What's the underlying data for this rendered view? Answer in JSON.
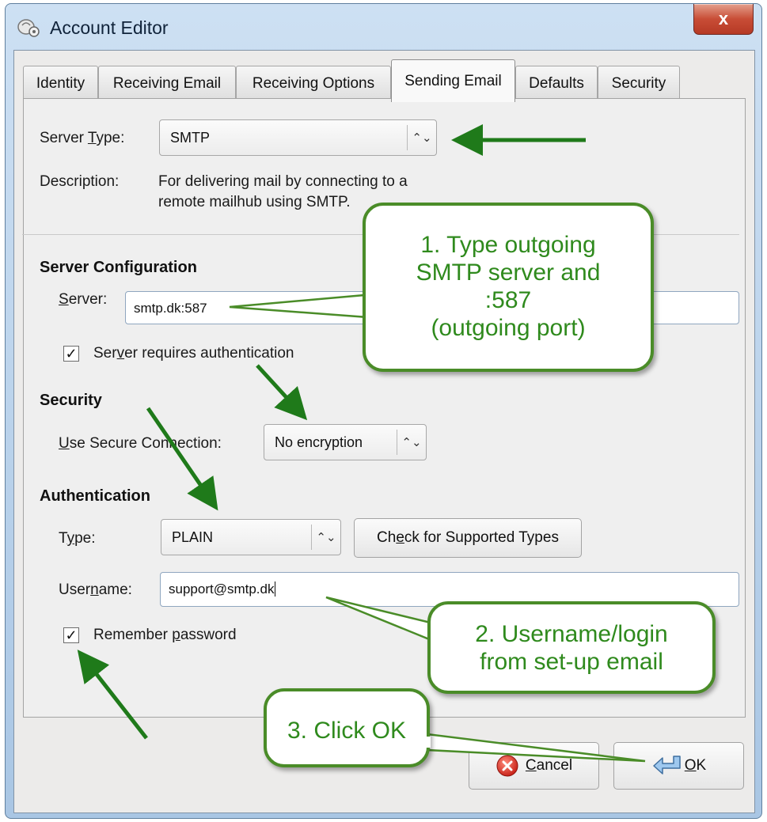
{
  "window": {
    "title": "Account Editor",
    "close_label": "x"
  },
  "tabs": [
    {
      "label": "Identity"
    },
    {
      "label": "Receiving Email"
    },
    {
      "label": "Receiving Options"
    },
    {
      "label": "Sending Email"
    },
    {
      "label": "Defaults"
    },
    {
      "label": "Security"
    }
  ],
  "server_type": {
    "label_pre": "Server ",
    "label_ul": "T",
    "label_post": "ype:",
    "value": "SMTP",
    "description_label": "Description:",
    "description_line1": "For delivering mail by connecting to a",
    "description_line2": "remote mailhub using SMTP."
  },
  "server_config": {
    "heading": "Server Configuration",
    "server_label_ul": "S",
    "server_label_post": "erver:",
    "server_value": "smtp.dk:587",
    "auth_check_pre": "Ser",
    "auth_check_ul": "v",
    "auth_check_post": "er requires authentication",
    "auth_checked": "✓"
  },
  "security": {
    "heading": "Security",
    "conn_label_ul": "U",
    "conn_label_post": "se Secure Connection:",
    "conn_value": "No encryption"
  },
  "authentication": {
    "heading": "Authentication",
    "type_label_pre": "T",
    "type_label_ul": "y",
    "type_label_post": "pe:",
    "type_value": "PLAIN",
    "check_btn_pre": "Ch",
    "check_btn_ul": "e",
    "check_btn_post": "ck for Supported Types",
    "username_label_pre": "User",
    "username_label_ul": "n",
    "username_label_post": "ame:",
    "username_value": "support@smtp.dk",
    "remember_pre": "Remember ",
    "remember_ul": "p",
    "remember_post": "assword",
    "remember_checked": "✓"
  },
  "buttons": {
    "cancel_ul": "C",
    "cancel_post": "ancel",
    "ok_ul": "O",
    "ok_post": "K"
  },
  "annotations": {
    "callout1_lines": [
      "1. Type outgoing",
      "SMTP server and",
      ":587",
      "(outgoing port)"
    ],
    "callout2_lines": [
      "2. Username/login",
      "from set-up email"
    ],
    "callout3": "3. Click OK"
  },
  "colors": {
    "annotation_green": "#2f8a1d",
    "annotation_border": "#4a8c28",
    "arrow_green": "#1f7a1a",
    "close_red": "#c84d36"
  }
}
